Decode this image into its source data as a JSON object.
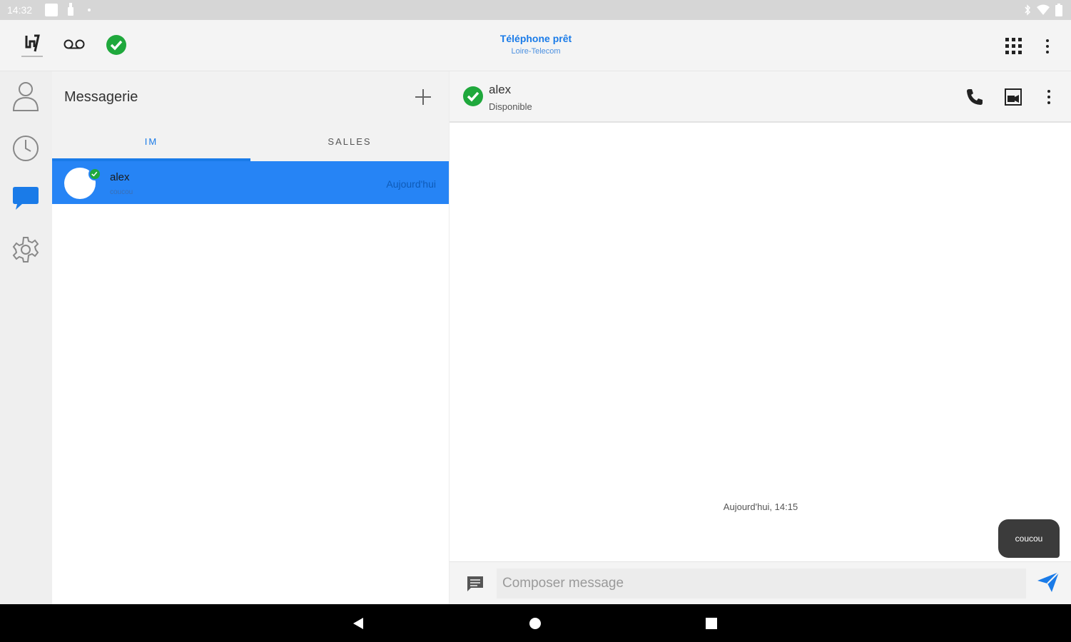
{
  "status_bar": {
    "time": "14:32"
  },
  "top_bar": {
    "title": "Téléphone prêt",
    "subtitle": "Loire-Telecom"
  },
  "icons": {
    "logo": "app-logo-icon",
    "voicemail": "voicemail-icon",
    "presence": "check-circle-icon",
    "dialpad": "dialpad-icon",
    "overflow": "more-vert-icon",
    "contacts": "person-icon",
    "history": "clock-icon",
    "messaging": "chat-bubble-icon",
    "settings": "gear-icon",
    "add": "plus-icon",
    "phone": "phone-icon",
    "video": "video-call-icon",
    "message": "message-icon",
    "send": "send-icon"
  },
  "colors": {
    "accent": "#1a7be8",
    "selected_row": "#2684f5",
    "presence_ok": "#1fa83c",
    "bubble": "#3b3b3b"
  },
  "list_pane": {
    "title": "Messagerie",
    "tabs": [
      {
        "label": "IM",
        "active": true
      },
      {
        "label": "SALLES",
        "active": false
      }
    ],
    "conversations": [
      {
        "name": "alex",
        "preview": "coucou",
        "date": "Aujourd'hui",
        "selected": true
      }
    ]
  },
  "chat": {
    "contact_name": "alex",
    "contact_status": "Disponible",
    "day_stamp": "Aujourd'hui, 14:15",
    "messages": [
      {
        "text": "coucou",
        "outgoing": true
      }
    ],
    "composer_placeholder": "Composer message"
  }
}
